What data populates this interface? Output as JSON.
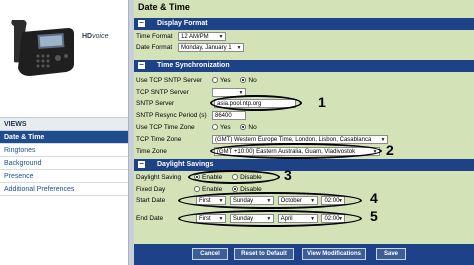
{
  "brand": {
    "hd": "HD",
    "voice": "voice"
  },
  "views": {
    "title": "VIEWS",
    "items": [
      "Date & Time",
      "Ringtones",
      "Background",
      "Presence",
      "Additional Preferences"
    ]
  },
  "page_title": "Date & Time",
  "sections": {
    "display_format": "Display Format",
    "time_sync": "Time Synchronization",
    "daylight": "Daylight Savings"
  },
  "display_format": {
    "time_label": "Time Format",
    "time_value": "12 AM/PM",
    "date_label": "Date Format",
    "date_value": "Monday, January 1"
  },
  "time_sync": {
    "use_sntp_label": "Use TCP SNTP Server",
    "yes": "Yes",
    "no": "No",
    "tcp_server_label": "TCP SNTP Server",
    "tcp_server_value": "",
    "sntp_server_label": "SNTP Server",
    "sntp_server_value": "asia.pool.ntp.org",
    "resync_label": "SNTP Resync Period (s)",
    "resync_value": "86400",
    "use_tz_label": "Use TCP Time Zone",
    "tcp_tz_label": "TCP Time Zone",
    "tcp_tz_value": "(GMT) Western Europe Time, London, Lisbon, Casablanca",
    "tz_label": "Time Zone",
    "tz_value": "(GMT +10:00) Eastern Australia, Guam, Vladivostok"
  },
  "daylight": {
    "saving_label": "Daylight Saving",
    "enable": "Enable",
    "disable": "Disable",
    "fixed_label": "Fixed Day",
    "start_label": "Start Date",
    "start": [
      "First",
      "Sunday",
      "October",
      "02:00"
    ],
    "end_label": "End Date",
    "end": [
      "First",
      "Sunday",
      "April",
      "02:00"
    ]
  },
  "annotations": [
    "1",
    "2",
    "3",
    "4",
    "5"
  ],
  "buttons": {
    "cancel": "Cancel",
    "reset": "Reset to Default",
    "view_mod": "View Modifications",
    "save": "Save"
  }
}
